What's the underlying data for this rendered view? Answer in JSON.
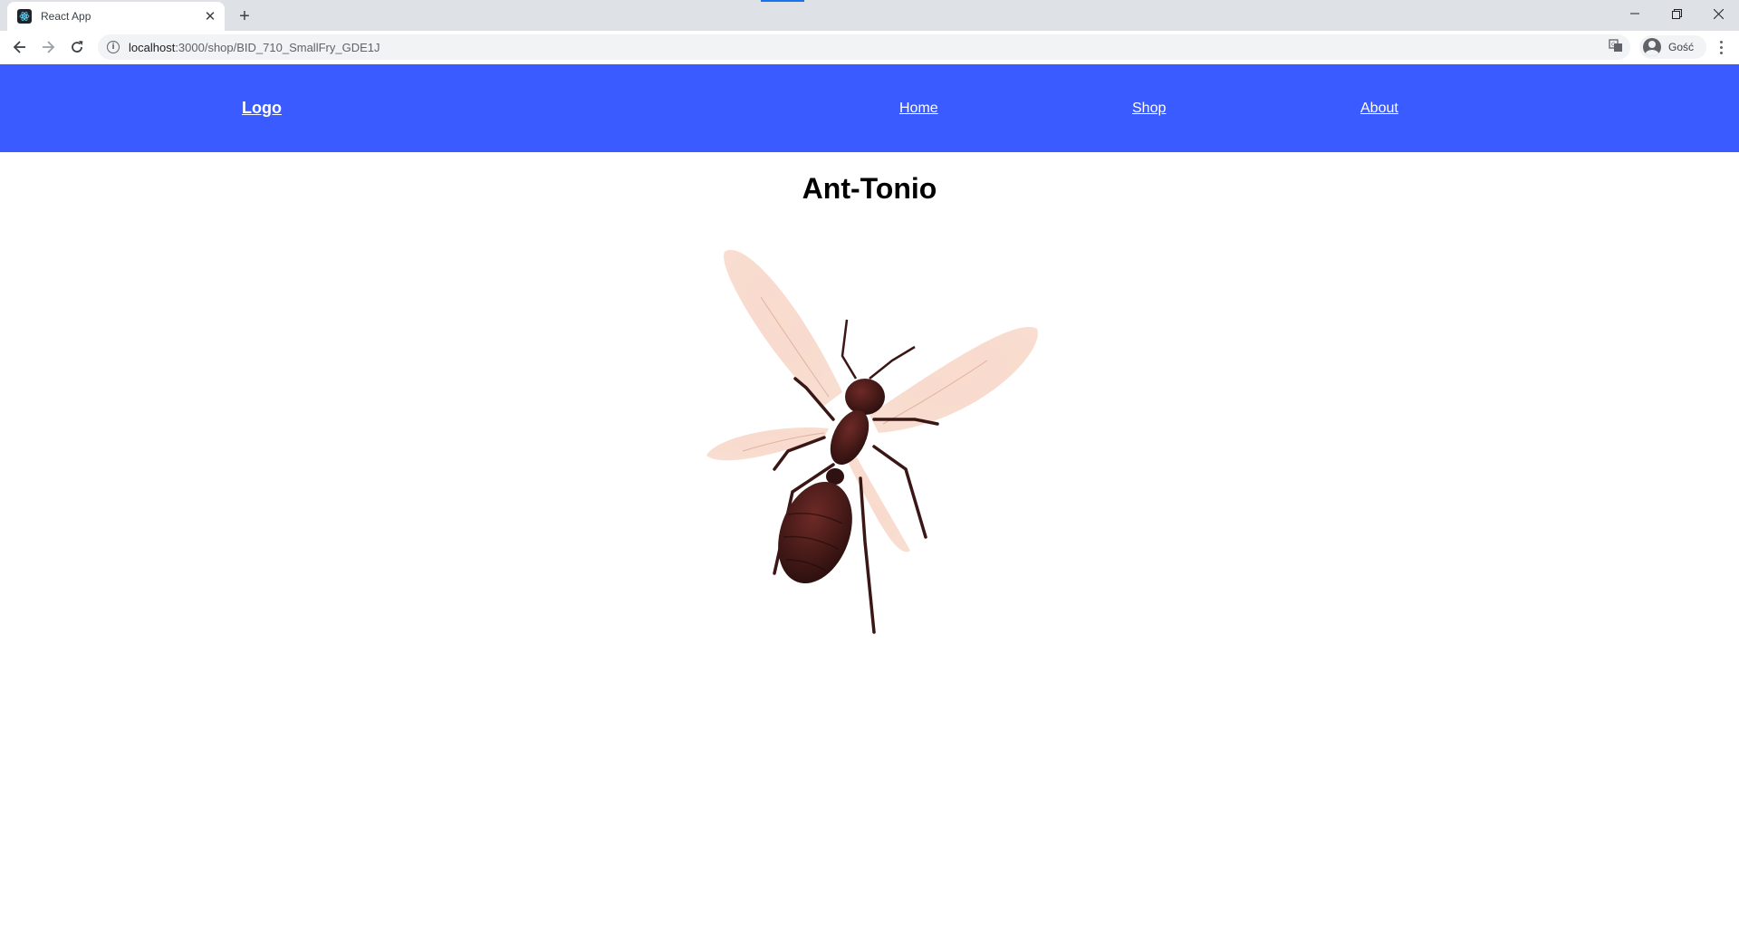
{
  "browser": {
    "tab_title": "React App",
    "tab_close": "✕",
    "new_tab": "+",
    "url_host": "localhost",
    "url_rest": ":3000/shop/BID_710_SmallFry_GDE1J",
    "profile_name": "Gość",
    "accent_color": "#1a73e8"
  },
  "navbar": {
    "logo": "Logo",
    "links": [
      "Home",
      "Shop",
      "About"
    ],
    "background": "#3a5bff"
  },
  "product": {
    "title": "Ant-Tonio",
    "image_icon": "winged-ant-image"
  }
}
